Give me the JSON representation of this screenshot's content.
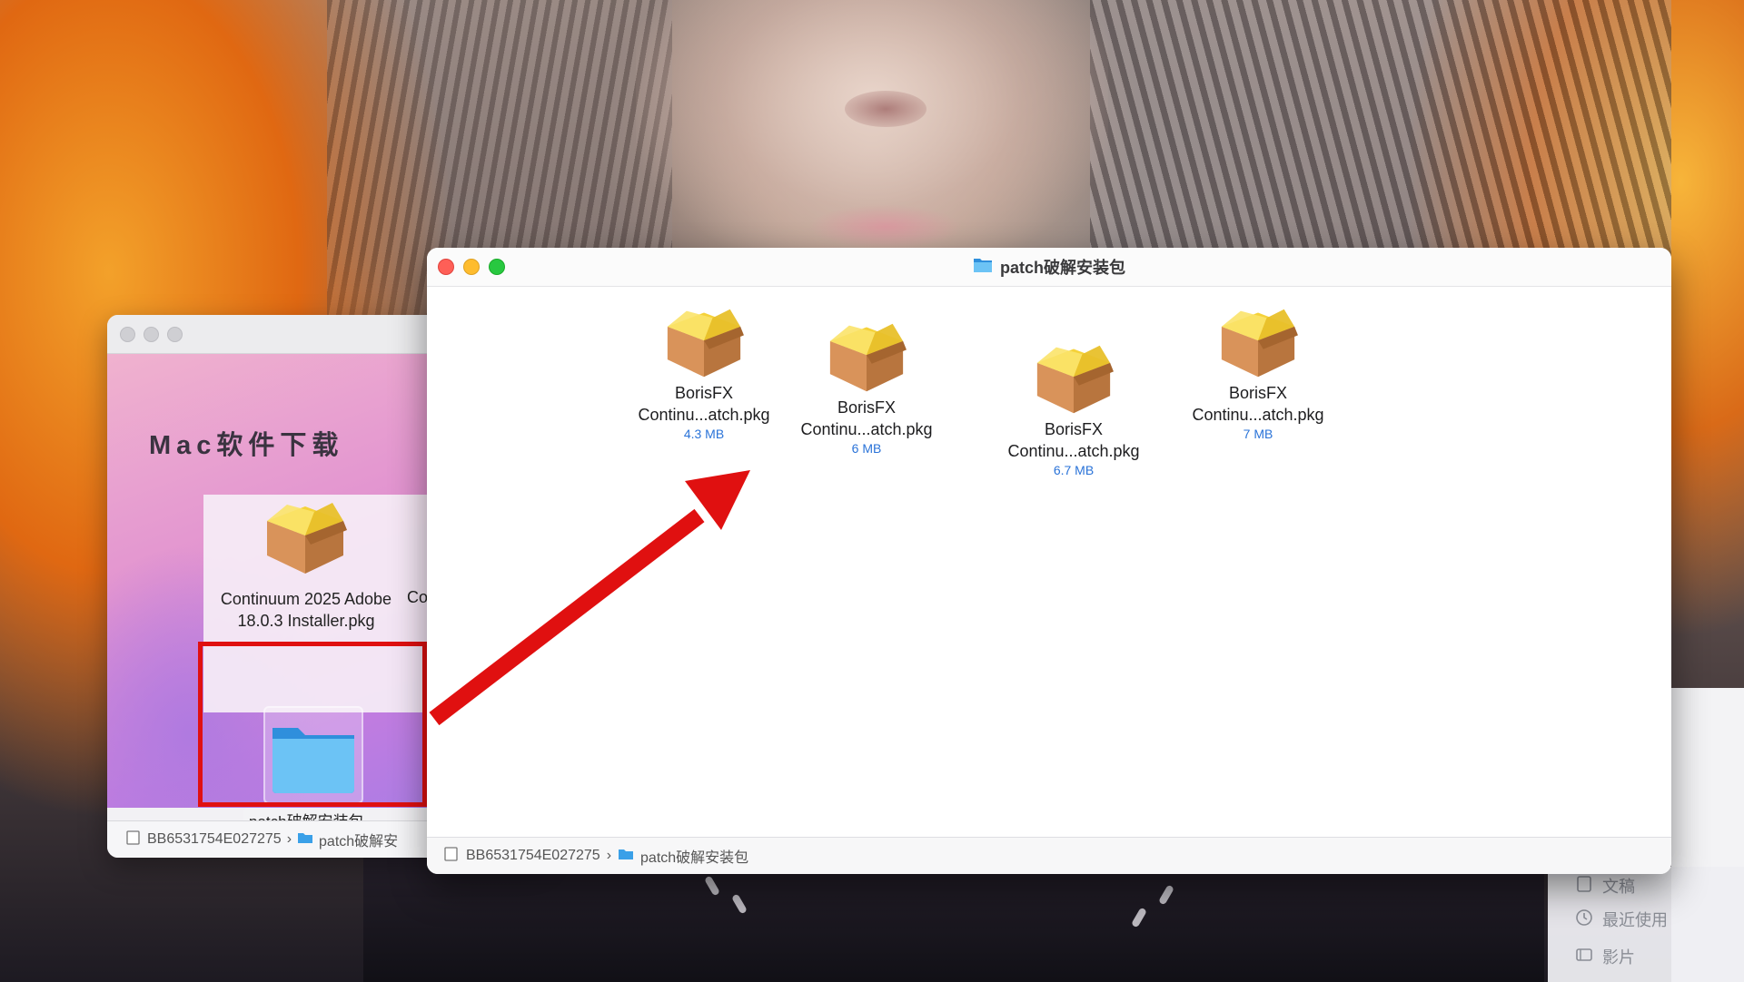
{
  "back_window": {
    "heading": "Mac软件下载",
    "file_label": "Continuum 2025 Adobe 18.0.3 Installer.pkg",
    "truncated_label": "Co",
    "folder_label": "patch破解安装包",
    "status_path": [
      "BB6531754E027275",
      "patch破解安"
    ]
  },
  "front_window": {
    "title": "patch破解安装包",
    "files": [
      {
        "name_line1": "BorisFX",
        "name_line2": "Continu...atch.pkg",
        "size": "4.3 MB"
      },
      {
        "name_line1": "BorisFX",
        "name_line2": "Continu...atch.pkg",
        "size": "6 MB"
      },
      {
        "name_line1": "BorisFX",
        "name_line2": "Continu...atch.pkg",
        "size": "6.7 MB"
      },
      {
        "name_line1": "BorisFX",
        "name_line2": "Continu...atch.pkg",
        "size": "7 MB"
      }
    ],
    "status_path": [
      "BB6531754E027275",
      "patch破解安装包"
    ]
  },
  "sidebar_partial": {
    "items": [
      {
        "label": "文稿",
        "icon": "document-icon"
      },
      {
        "label": "最近使用",
        "icon": "clock-icon"
      },
      {
        "label": "影片",
        "icon": "film-icon"
      }
    ]
  },
  "colors": {
    "highlight": "#e01010",
    "arrow": "#e01010",
    "size_text": "#2a73d8",
    "folder": "#6cc3f5"
  }
}
